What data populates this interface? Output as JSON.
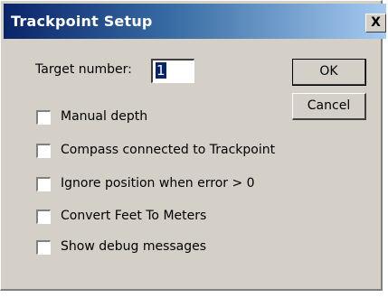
{
  "dialog": {
    "title": "Trackpoint Setup",
    "close_glyph": "X",
    "close_icon": "close-icon"
  },
  "form": {
    "target_label": "Target number:",
    "target_value": "1",
    "ok_label": "OK",
    "cancel_label": "Cancel",
    "options": [
      {
        "label": "Manual depth",
        "checked": false
      },
      {
        "label": "Compass connected to Trackpoint",
        "checked": false
      },
      {
        "label": "Ignore position when error > 0",
        "checked": false
      },
      {
        "label": "Convert Feet To Meters",
        "checked": false
      },
      {
        "label": "Show debug messages",
        "checked": false
      }
    ]
  }
}
